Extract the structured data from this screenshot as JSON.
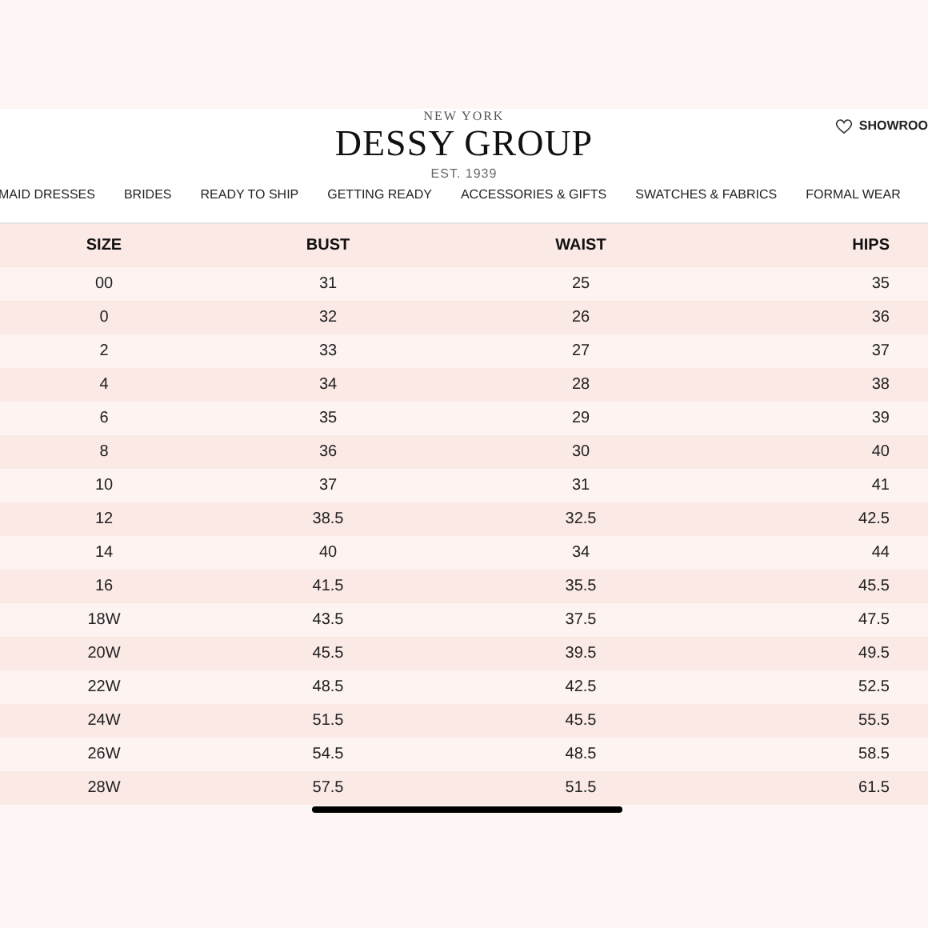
{
  "header": {
    "tagline": "NEW YORK",
    "logo": "DESSY GROUP",
    "established": "EST. 1939",
    "showroom": "SHOWROO"
  },
  "nav": [
    "MAID DRESSES",
    "BRIDES",
    "READY TO SHIP",
    "GETTING READY",
    "ACCESSORIES & GIFTS",
    "SWATCHES & FABRICS",
    "FORMAL WEAR"
  ],
  "table": {
    "columns": [
      "SIZE",
      "BUST",
      "WAIST",
      "HIPS"
    ],
    "rows": [
      [
        "00",
        "31",
        "25",
        "35"
      ],
      [
        "0",
        "32",
        "26",
        "36"
      ],
      [
        "2",
        "33",
        "27",
        "37"
      ],
      [
        "4",
        "34",
        "28",
        "38"
      ],
      [
        "6",
        "35",
        "29",
        "39"
      ],
      [
        "8",
        "36",
        "30",
        "40"
      ],
      [
        "10",
        "37",
        "31",
        "41"
      ],
      [
        "12",
        "38.5",
        "32.5",
        "42.5"
      ],
      [
        "14",
        "40",
        "34",
        "44"
      ],
      [
        "16",
        "41.5",
        "35.5",
        "45.5"
      ],
      [
        "18W",
        "43.5",
        "37.5",
        "47.5"
      ],
      [
        "20W",
        "45.5",
        "39.5",
        "49.5"
      ],
      [
        "22W",
        "48.5",
        "42.5",
        "52.5"
      ],
      [
        "24W",
        "51.5",
        "45.5",
        "55.5"
      ],
      [
        "26W",
        "54.5",
        "48.5",
        "58.5"
      ],
      [
        "28W",
        "57.5",
        "51.5",
        "61.5"
      ]
    ]
  }
}
